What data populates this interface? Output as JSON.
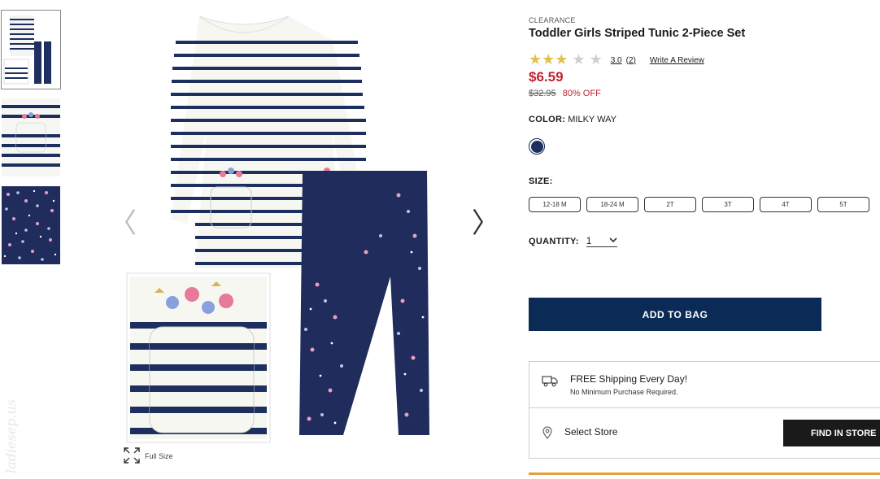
{
  "product": {
    "badge": "CLEARANCE",
    "title": "Toddler Girls Striped Tunic 2-Piece Set",
    "rating_value": "3.0",
    "rating_stars": 3,
    "rating_count": "(2)",
    "write_review": "Write A Review",
    "price": "$6.59",
    "old_price": "$32.95",
    "discount": "80% OFF"
  },
  "color": {
    "label": "COLOR:",
    "value": "MILKY WAY",
    "swatch": "#1d2f5e"
  },
  "size": {
    "label": "SIZE:",
    "options": [
      "12-18 M",
      "18-24 M",
      "2T",
      "3T",
      "4T",
      "5T"
    ]
  },
  "quantity": {
    "label": "QUANTITY:",
    "value": "1"
  },
  "actions": {
    "add_to_bag": "ADD TO BAG",
    "find_in_store": "FIND IN STORE"
  },
  "shipping": {
    "title": "FREE Shipping Every Day!",
    "subtitle": "No Minimum Purchase Required."
  },
  "store": {
    "label": "Select Store"
  },
  "gallery": {
    "full_size": "Full Size",
    "watermark": "ladiesep.us"
  },
  "colors": {
    "navy": "#0b2a55",
    "sale_red": "#c0232f",
    "star": "#e0c24a",
    "accent_line": "#e2a13c"
  }
}
